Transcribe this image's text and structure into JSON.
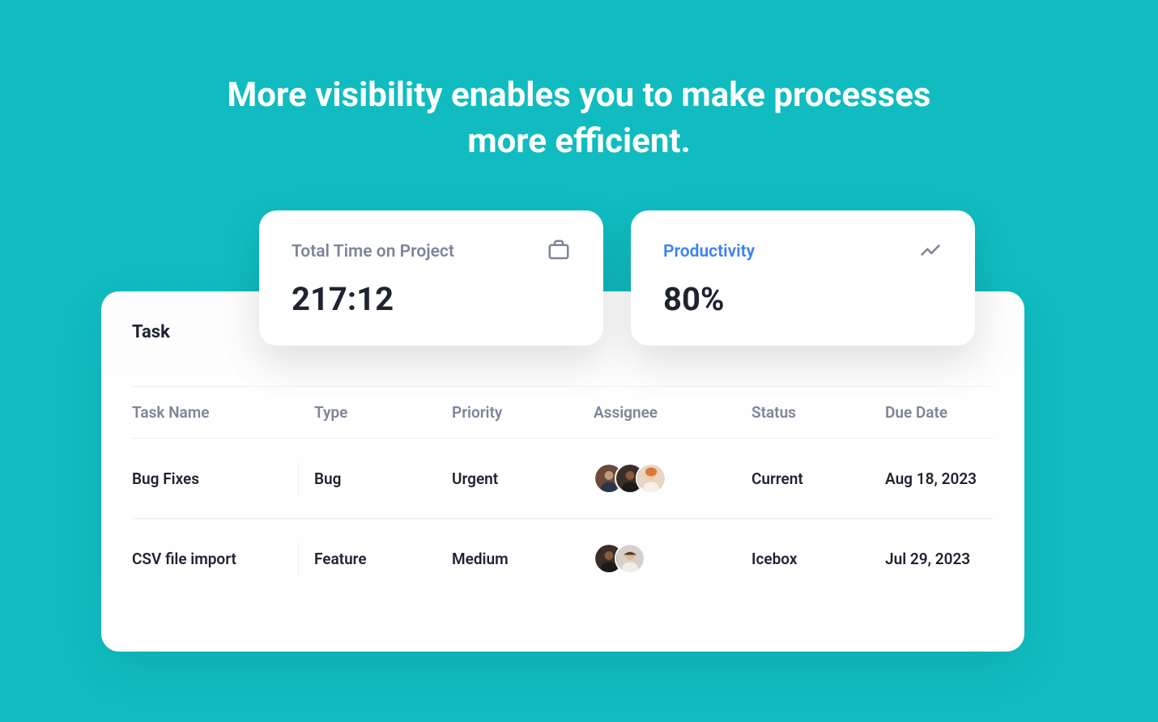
{
  "headline": "More visibility enables you to make processes more efficient.",
  "metrics": {
    "time": {
      "label": "Total Time on Project",
      "value": "217:12"
    },
    "productivity": {
      "label": "Productivity",
      "value": "80%"
    }
  },
  "task_panel": {
    "title": "Task",
    "columns": {
      "name": "Task Name",
      "type": "Type",
      "priority": "Priority",
      "assignee": "Assignee",
      "status": "Status",
      "due_date": "Due Date"
    },
    "rows": [
      {
        "name": "Bug Fixes",
        "type": "Bug",
        "priority": "Urgent",
        "assignee_count": 3,
        "status": "Current",
        "due_date": "Aug 18, 2023"
      },
      {
        "name": "CSV file import",
        "type": "Feature",
        "priority": "Medium",
        "assignee_count": 2,
        "status": "Icebox",
        "due_date": "Jul 29, 2023"
      }
    ]
  }
}
